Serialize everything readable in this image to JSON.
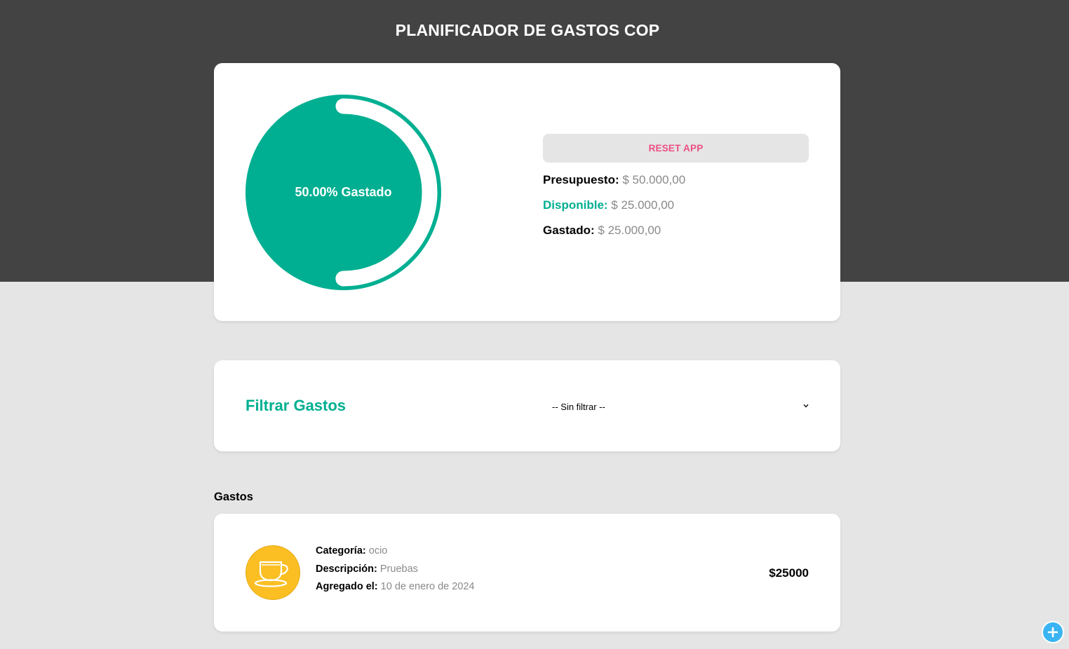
{
  "header": {
    "title": "PLANIFICADOR DE GASTOS COP"
  },
  "budget": {
    "progress_percent": 50,
    "progress_label": "50.00% Gastado",
    "reset_label": "RESET APP",
    "presupuesto_label": "Presupuesto:",
    "presupuesto_value": "$ 50.000,00",
    "disponible_label": "Disponible:",
    "disponible_value": "$ 25.000,00",
    "gastado_label": "Gastado:",
    "gastado_value": "$ 25.000,00",
    "colors": {
      "progress": "#00af91",
      "track": "#ffffff",
      "reset_text": "#ec4f84"
    }
  },
  "filter": {
    "title": "Filtrar Gastos",
    "selected": "-- Sin filtrar --",
    "icon": "chevron-down-icon"
  },
  "expenses": {
    "heading": "Gastos",
    "items": [
      {
        "icon": "coffee-cup-icon",
        "icon_color": "#fbbf24",
        "category_label": "Categoría:",
        "category_value": "ocio",
        "description_label": "Descripción:",
        "description_value": "Pruebas",
        "date_label": "Agregado el:",
        "date_value": "10 de enero de 2024",
        "amount": "$25000"
      }
    ]
  },
  "fab": {
    "icon": "plus-icon",
    "color": "#3ab4f2"
  }
}
